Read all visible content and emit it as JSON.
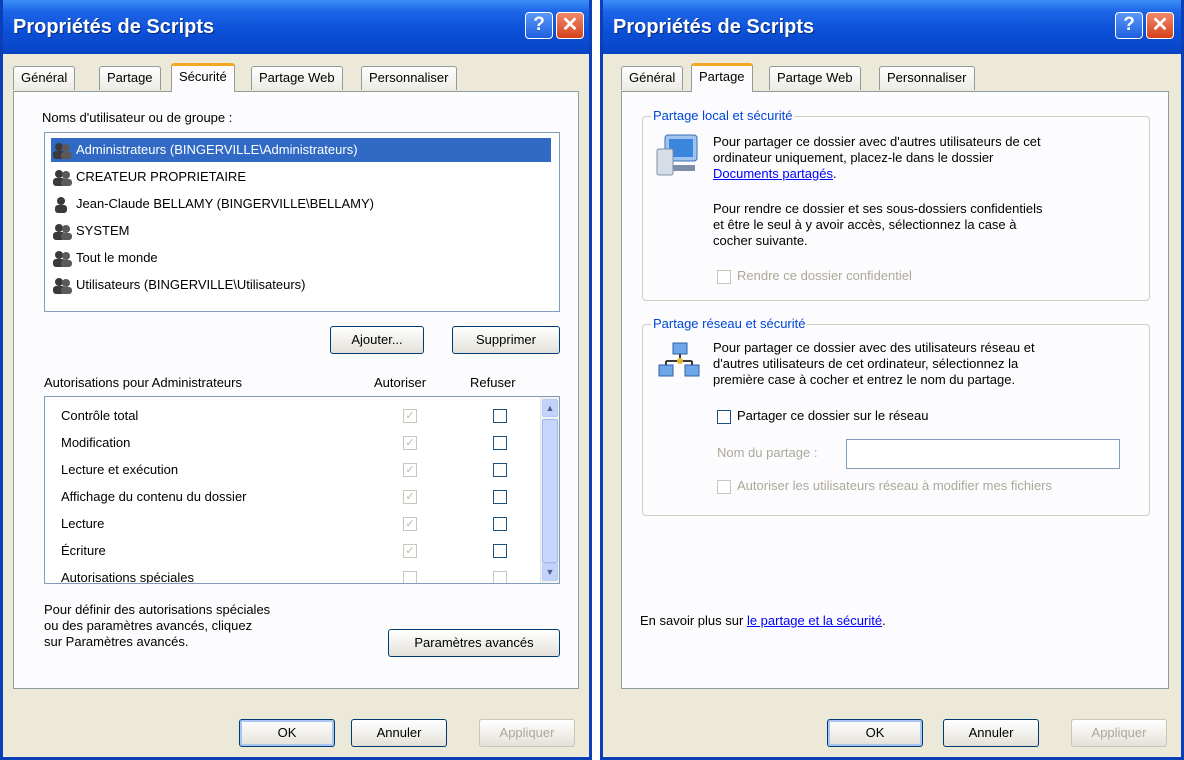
{
  "left": {
    "title": "Propriétés de Scripts",
    "help_glyph": "?",
    "close_glyph": "✕",
    "tabs": [
      "Général",
      "Partage",
      "Sécurité",
      "Partage Web",
      "Personnaliser"
    ],
    "active_tab": "Sécurité",
    "users_label": "Noms d'utilisateur ou de groupe :",
    "users": [
      "Administrateurs (BINGERVILLE\\Administrateurs)",
      "CREATEUR PROPRIETAIRE",
      "Jean-Claude BELLAMY (BINGERVILLE\\BELLAMY)",
      "SYSTEM",
      "Tout le monde",
      "Utilisateurs (BINGERVILLE\\Utilisateurs)"
    ],
    "selected_user": "Administrateurs (BINGERVILLE\\Administrateurs)",
    "add_button": "Ajouter...",
    "remove_button": "Supprimer",
    "perm_label": "Autorisations pour Administrateurs",
    "allow_header": "Autoriser",
    "deny_header": "Refuser",
    "permissions": [
      {
        "name": "Contrôle total",
        "allow": true,
        "deny": false
      },
      {
        "name": "Modification",
        "allow": true,
        "deny": false
      },
      {
        "name": "Lecture et exécution",
        "allow": true,
        "deny": false
      },
      {
        "name": "Affichage du contenu du dossier",
        "allow": true,
        "deny": false
      },
      {
        "name": "Lecture",
        "allow": true,
        "deny": false
      },
      {
        "name": "Écriture",
        "allow": true,
        "deny": false
      },
      {
        "name": "Autorisations spéciales",
        "allow": false,
        "deny": false
      }
    ],
    "advanced_text": [
      "Pour définir des autorisations spéciales",
      "ou des paramètres avancés, cliquez",
      "sur Paramètres avancés."
    ],
    "advanced_button": "Paramètres avancés",
    "ok": "OK",
    "cancel": "Annuler",
    "apply": "Appliquer"
  },
  "right": {
    "title": "Propriétés de Scripts",
    "help_glyph": "?",
    "close_glyph": "✕",
    "tabs": [
      "Général",
      "Partage",
      "Partage Web",
      "Personnaliser"
    ],
    "active_tab": "Partage",
    "local_group_title": "Partage local et sécurité",
    "local_text_1": [
      "Pour partager ce dossier avec d'autres utilisateurs de cet",
      "ordinateur uniquement, placez-le dans le dossier"
    ],
    "local_link": "Documents partagés",
    "local_text_1_end": ".",
    "local_text_2": [
      "Pour rendre ce dossier et ses sous-dossiers confidentiels",
      "et être le seul à y avoir accès, sélectionnez la case à",
      "cocher suivante."
    ],
    "private_checkbox": "Rendre ce dossier confidentiel",
    "network_group_title": "Partage réseau et sécurité",
    "network_text": [
      "Pour partager ce dossier avec des utilisateurs réseau et",
      "d'autres utilisateurs de cet ordinateur, sélectionnez la",
      "première case à cocher et entrez le nom du partage."
    ],
    "share_checkbox": "Partager ce dossier sur le réseau",
    "share_name_label": "Nom du partage :",
    "share_name_value": "",
    "allow_modify_checkbox": "Autoriser les utilisateurs réseau à modifier mes fichiers",
    "learn_prefix": "En savoir plus sur ",
    "learn_link": "le partage et la sécurité",
    "learn_suffix": ".",
    "ok": "OK",
    "cancel": "Annuler",
    "apply": "Appliquer"
  }
}
